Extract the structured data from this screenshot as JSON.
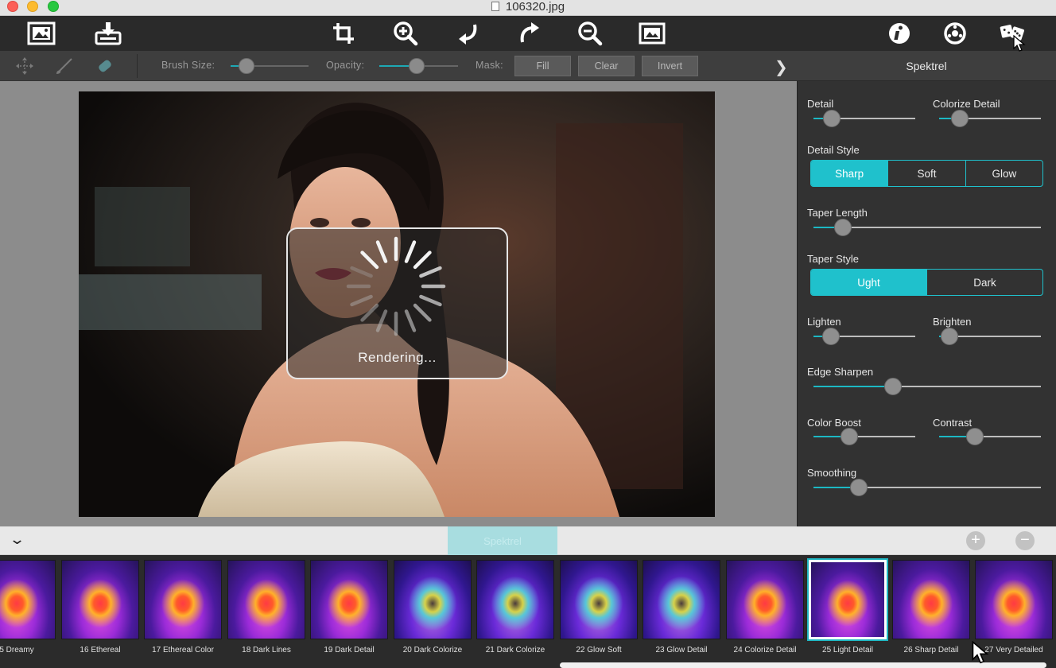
{
  "window": {
    "title": "106320.jpg"
  },
  "toolbar": {
    "left_icons": [
      "open-image-icon",
      "save-export-icon"
    ],
    "center_icons": [
      "crop-icon",
      "zoom-in-icon",
      "undo-icon",
      "redo-icon",
      "zoom-out-icon",
      "fit-to-screen-icon"
    ],
    "right_icons": [
      "info-icon",
      "settings-icon",
      "randomize-dice-icon"
    ]
  },
  "subbar": {
    "brush_size_label": "Brush Size:",
    "brush_size_value": 0.2,
    "opacity_label": "Opacity:",
    "opacity_value": 0.47,
    "mask_label": "Mask:",
    "fill_label": "Fill",
    "clear_label": "Clear",
    "invert_label": "Invert"
  },
  "canvas": {
    "overlay_text": "Rendering..."
  },
  "panel": {
    "title": "Spektrel",
    "detail": {
      "label": "Detail",
      "value": 0.18
    },
    "colorize_detail": {
      "label": "Colorize Detail",
      "value": 0.2
    },
    "detail_style": {
      "label": "Detail Style",
      "options": [
        "Sharp",
        "Soft",
        "Glow"
      ],
      "selected": "Sharp"
    },
    "taper_length": {
      "label": "Taper Length",
      "value": 0.13
    },
    "taper_style": {
      "label": "Taper Style",
      "options": [
        "Ught",
        "Dark"
      ],
      "selected": "Ught"
    },
    "lighten": {
      "label": "Lighten",
      "value": 0.17
    },
    "brighten": {
      "label": "Brighten",
      "value": 0.1
    },
    "edge_sharpen": {
      "label": "Edge Sharpen",
      "value": 0.35
    },
    "color_boost": {
      "label": "Color Boost",
      "value": 0.35
    },
    "contrast": {
      "label": "Contrast",
      "value": 0.35
    },
    "smoothing": {
      "label": "Smoothing",
      "value": 0.2
    }
  },
  "strip": {
    "active_tab": "Spektrel",
    "presets": [
      {
        "label": "5 Dreamy",
        "style": "warm"
      },
      {
        "label": "16 Ethereal",
        "style": "warm"
      },
      {
        "label": "17 Ethereal Color",
        "style": "warm"
      },
      {
        "label": "18 Dark Lines",
        "style": "warm"
      },
      {
        "label": "19 Dark Detail",
        "style": "warm"
      },
      {
        "label": "20 Dark Colorize",
        "style": "cool"
      },
      {
        "label": "21 Dark Colorize",
        "style": "cool"
      },
      {
        "label": "22 Glow Soft",
        "style": "cool"
      },
      {
        "label": "23 Glow Detail",
        "style": "cool"
      },
      {
        "label": "24 Colorize Detail",
        "style": "warm"
      },
      {
        "label": "25 Light Detail",
        "style": "warm"
      },
      {
        "label": "26 Sharp Detail",
        "style": "warm"
      },
      {
        "label": "27 Very Detailed",
        "style": "warm"
      }
    ],
    "selected_preset": "25 Light Detail"
  },
  "colors": {
    "accent": "#1fc1cc",
    "panel_bg": "#323232",
    "toolbar_bg": "#2a2a2a"
  }
}
